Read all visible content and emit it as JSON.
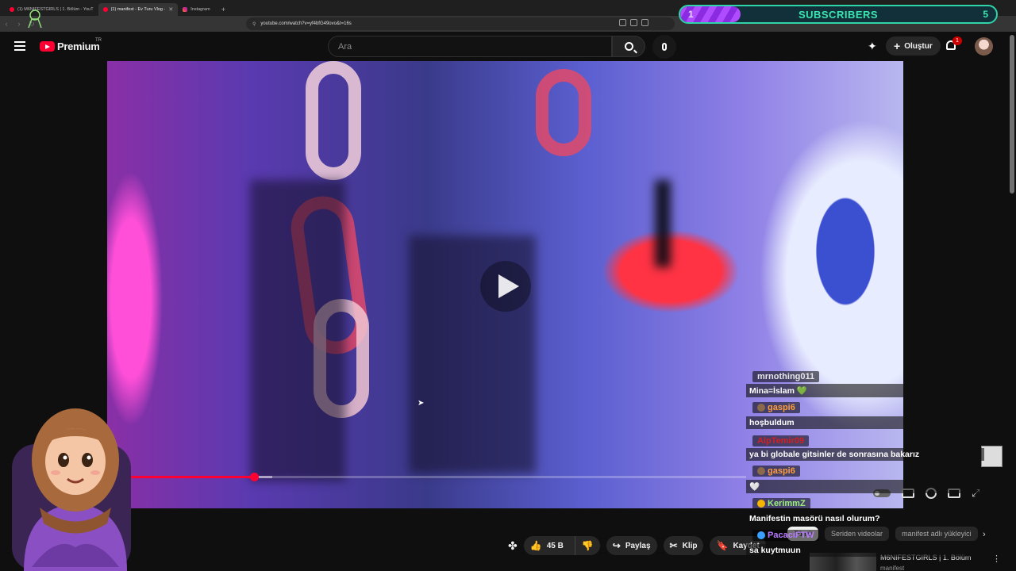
{
  "browser": {
    "tabs": [
      {
        "title": "(1) M6NIFESTGIRLS | 1. Bölüm - YouT",
        "active": false,
        "favicon": "youtube-icon"
      },
      {
        "title": "(1) manifest - Ev Turu Vlog -",
        "active": true,
        "favicon": "youtube-icon"
      },
      {
        "title": "Instagram",
        "active": false,
        "favicon": "instagram-icon"
      }
    ],
    "url": "youtube.com/watch?v=yf4bfG49ovo&t=16s"
  },
  "overlay": {
    "subscribers": {
      "current": "1",
      "label": "SUBSCRIBERS",
      "goal": "5",
      "progress": 0.19
    }
  },
  "youtube": {
    "logo_text": "Premium",
    "region": "TR",
    "search_placeholder": "Ara",
    "create_label": "Oluştur",
    "notification_count": "1"
  },
  "player": {
    "progress_played": 0.205,
    "progress_buffered": 0.235
  },
  "actions": {
    "likes": "45 B",
    "share": "Paylaş",
    "clip": "Klip",
    "save": "Kaydet"
  },
  "related": {
    "chips": [
      "Tümü",
      "Seriden videolar",
      "manifest adlı yükleyici"
    ],
    "item_title": "M6NIFESTGIRLS | 1. Bölüm",
    "item_channel": "manifest"
  },
  "chat": [
    {
      "user": "mrnothing011",
      "text": "Mina=İslam 💚",
      "color": "#e6e6e6",
      "badge": null
    },
    {
      "user": "gaspi6",
      "text": "hoşbuldum",
      "color": "#ff9d3c",
      "badge": "bear"
    },
    {
      "user": "AlpTemir09",
      "text": "ya bi globale gitsinler de sonrasına bakarız",
      "color": "#d61f1f",
      "badge": null
    },
    {
      "user": "gaspi6",
      "text": "🤍",
      "color": "#ff9d3c",
      "badge": "bear"
    },
    {
      "user": "KerimmZ",
      "text": "Manifestin masörü nasıl olurum?",
      "color": "#9bf07b",
      "badge": "gold"
    },
    {
      "user": "PacaciFTW",
      "text": "sa kuytmuun",
      "color": "#b77cff",
      "badge": "blue-gold"
    }
  ]
}
